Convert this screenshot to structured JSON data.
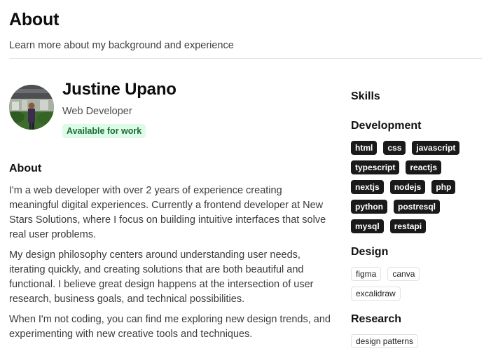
{
  "header": {
    "title": "About",
    "subtitle": "Learn more about my background and experience"
  },
  "profile": {
    "name": "Justine Upano",
    "role": "Web Developer",
    "status": "Available for work"
  },
  "about": {
    "heading": "About",
    "paragraphs": [
      "I'm a web developer with over 2 years of experience creating meaningful digital experiences. Currently a frontend developer at New Stars Solutions, where I focus on building intuitive interfaces that solve real user problems.",
      "My design philosophy centers around understanding user needs, iterating quickly, and creating solutions that are both beautiful and functional. I believe great design happens at the intersection of user research, business goals, and technical possibilities.",
      "When I'm not coding, you can find me exploring new design trends, and experimenting with new creative tools and techniques."
    ]
  },
  "skills": {
    "title": "Skills",
    "development": {
      "title": "Development",
      "tags": [
        "html",
        "css",
        "javascript",
        "typescript",
        "reactjs",
        "nextjs",
        "nodejs",
        "php",
        "python",
        "postresql",
        "mysql",
        "restapi"
      ]
    },
    "design": {
      "title": "Design",
      "tags": [
        "figma",
        "canva",
        "excalidraw"
      ]
    },
    "research": {
      "title": "Research",
      "tags": [
        "design patterns"
      ]
    }
  },
  "colors": {
    "badge_bg": "#dcfce7",
    "badge_text": "#1a6b34",
    "tag_dark_bg": "#1a1a1a"
  }
}
